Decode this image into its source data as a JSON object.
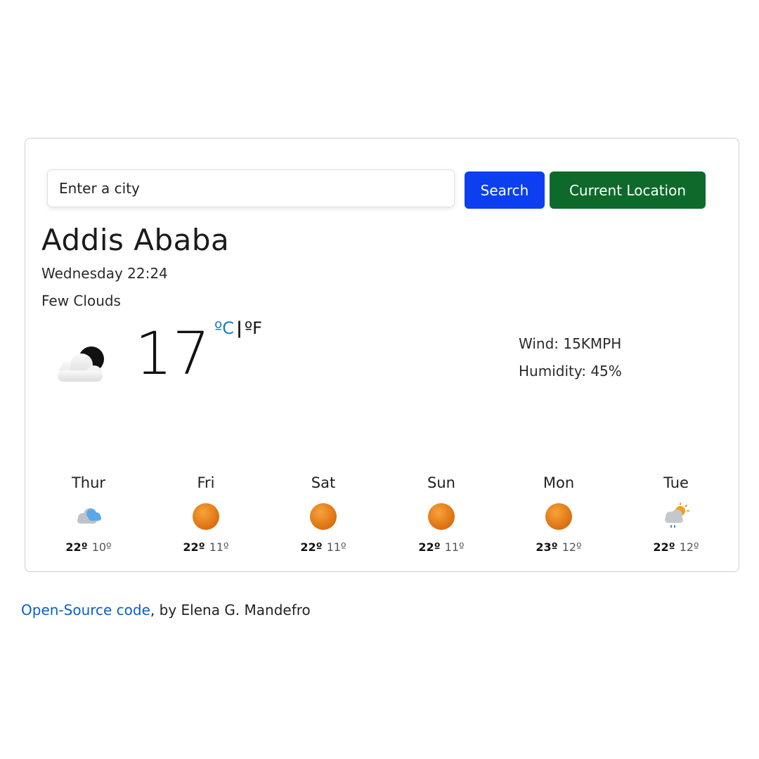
{
  "search": {
    "placeholder": "Enter a city",
    "search_label": "Search",
    "location_label": "Current Location"
  },
  "current": {
    "city": "Addis Ababa",
    "datetime": "Wednesday 22:24",
    "description": "Few Clouds",
    "icon": "few-clouds-night-icon",
    "temperature": "17",
    "unit_c": "ºC",
    "unit_sep": "|",
    "unit_f": "ºF",
    "wind": "Wind: 15KMPH",
    "humidity": "Humidity: 45%"
  },
  "forecast": [
    {
      "day": "Thur",
      "icon": "cloud-rain-icon",
      "max": "22º",
      "min": "10º"
    },
    {
      "day": "Fri",
      "icon": "sun-icon",
      "max": "22º",
      "min": "11º"
    },
    {
      "day": "Sat",
      "icon": "sun-icon",
      "max": "22º",
      "min": "11º"
    },
    {
      "day": "Sun",
      "icon": "sun-icon",
      "max": "22º",
      "min": "11º"
    },
    {
      "day": "Mon",
      "icon": "sun-icon",
      "max": "23º",
      "min": "12º"
    },
    {
      "day": "Tue",
      "icon": "sun-cloud-rain-icon",
      "max": "22º",
      "min": "12º"
    }
  ],
  "footer": {
    "link_text": "Open-Source code",
    "credit": ", by Elena G. Mandefro"
  },
  "colors": {
    "search_button": "#0b3ff0",
    "location_button": "#0e6a2a",
    "celsius_active": "#1a7dc4",
    "link": "#0b5fc4",
    "sun": "#e07a0a"
  }
}
